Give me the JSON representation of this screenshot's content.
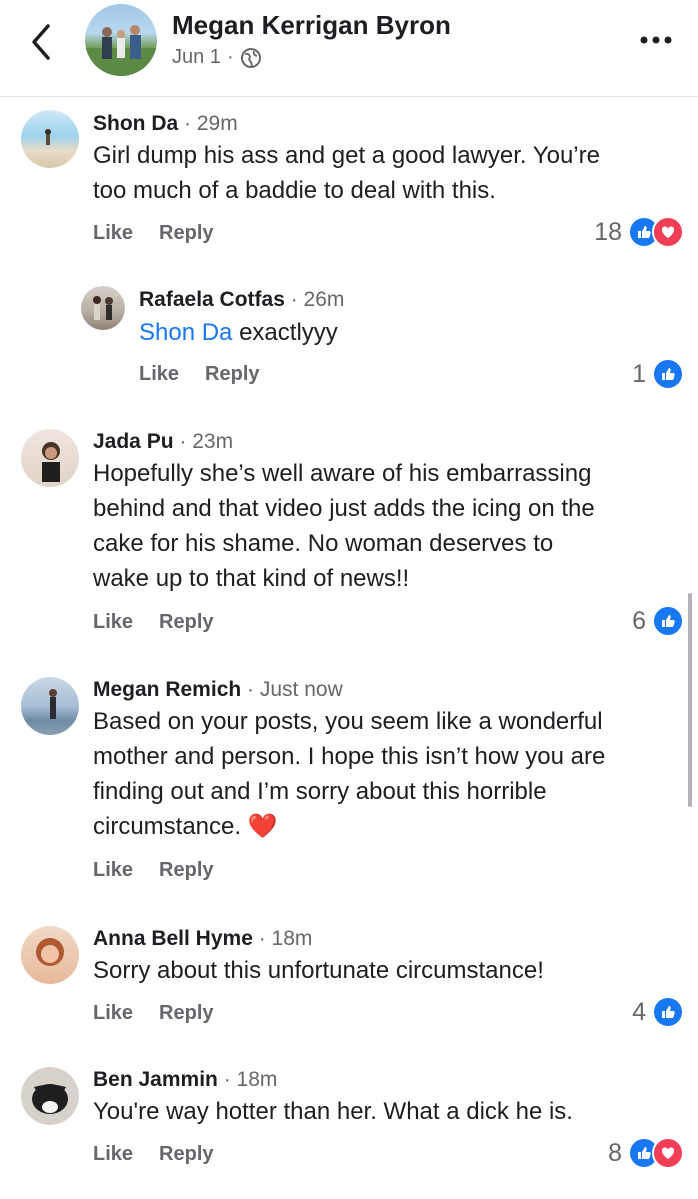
{
  "header": {
    "title": "Megan Kerrigan Byron",
    "date": "Jun 1",
    "separator": "·",
    "privacy_icon": "globe-icon",
    "back_icon": "chevron-left-icon",
    "more_icon": "more-horizontal-icon"
  },
  "actions": {
    "like": "Like",
    "reply": "Reply"
  },
  "colors": {
    "accent": "#1877f2",
    "love": "#f33e58",
    "muted": "#65676b"
  },
  "comments": [
    {
      "author": "Shon Da",
      "time": "· 29m",
      "lines": [
        "Girl dump his ass and get a good lawyer. You’re",
        "too much of a baddie to deal with this."
      ],
      "reaction_count": "18",
      "reactions": [
        "like",
        "love"
      ]
    },
    {
      "author": "Rafaela Cotfas",
      "time": "· 26m",
      "mention": "Shon Da",
      "text": " exactlyyy",
      "reaction_count": "1",
      "reactions": [
        "like"
      ]
    },
    {
      "author": "Jada Pu",
      "time": "· 23m",
      "lines": [
        "Hopefully she’s well aware of his embarrassing",
        "behind and that video just adds the icing on the",
        "cake for his shame. No woman deserves to",
        "wake up to that kind of news!!"
      ],
      "reaction_count": "6",
      "reactions": [
        "like"
      ]
    },
    {
      "author": "Megan Remich",
      "time": "· Just now",
      "lines": [
        "Based on your posts, you seem like a wonderful",
        "mother and person. I hope this isn’t how you are",
        "finding out and I’m sorry about this horrible",
        "circumstance."
      ],
      "emoji": "❤️"
    },
    {
      "author": "Anna Bell Hyme",
      "time": "· 18m",
      "lines": [
        "Sorry about this unfortunate circumstance!"
      ],
      "reaction_count": "4",
      "reactions": [
        "like"
      ]
    },
    {
      "author": "Ben Jammin",
      "time": "· 18m",
      "lines": [
        "You're way hotter than her. What a dick he is."
      ],
      "reaction_count": "8",
      "reactions": [
        "like",
        "love"
      ]
    }
  ]
}
